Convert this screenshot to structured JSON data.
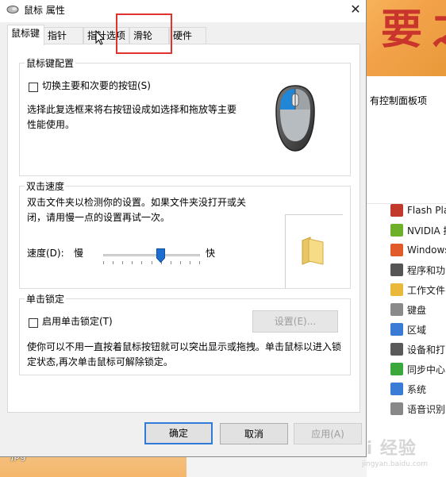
{
  "background": {
    "photo_chars": [
      "要",
      "之"
    ],
    "all_items_text": "有控制面板项",
    "items": [
      {
        "label": "Flash Pla",
        "icon": "flash-icon",
        "color": "#c0392b"
      },
      {
        "label": "NVIDIA 控",
        "icon": "nvidia-icon",
        "color": "#6fb02a"
      },
      {
        "label": "Windows",
        "icon": "windows-defender-icon",
        "color": "#e05a2a"
      },
      {
        "label": "程序和功",
        "icon": "programs-icon",
        "color": "#555555"
      },
      {
        "label": "工作文件",
        "icon": "work-folders-icon",
        "color": "#e8b93a"
      },
      {
        "label": "键盘",
        "icon": "keyboard-icon",
        "color": "#8a8a8a"
      },
      {
        "label": "区域",
        "icon": "region-icon",
        "color": "#3a7bd5"
      },
      {
        "label": "设备和打",
        "icon": "devices-printers-icon",
        "color": "#5a5a5a"
      },
      {
        "label": "同步中心",
        "icon": "sync-center-icon",
        "color": "#3aa83a"
      },
      {
        "label": "系统",
        "icon": "system-icon",
        "color": "#3a7bd5"
      },
      {
        "label": "语音识别",
        "icon": "speech-recognition-icon",
        "color": "#888888"
      }
    ],
    "file_label": "jpg",
    "watermark": "Bai 经验",
    "watermark_url": "jingyan.baidu.com"
  },
  "dialog": {
    "title": "鼠标 属性",
    "close_glyph": "✕",
    "tabs": [
      "鼠标键",
      "指针",
      "指针选项",
      "滑轮",
      "硬件"
    ],
    "active_tab": 0,
    "button_config": {
      "group_label": "鼠标键配置",
      "switch_label": "切换主要和次要的按钮(S)",
      "switch_checked": false,
      "description": "选择此复选框来将右按钮设成如选择和拖放等主要性能使用。"
    },
    "double_click": {
      "group_label": "双击速度",
      "description": "双击文件夹以检测你的设置。如果文件夹没打开或关闭，请用慢一点的设置再试一次。",
      "speed_label": "速度(D):",
      "slow_label": "慢",
      "fast_label": "快",
      "speed_value": 0.6
    },
    "click_lock": {
      "group_label": "单击锁定",
      "enable_label": "启用单击锁定(T)",
      "enable_checked": false,
      "settings_button": "设置(E)...",
      "description": "使你可以不用一直按着鼠标按钮就可以突出显示或拖拽。单击鼠标以进入锁定状态,再次单击鼠标可解除锁定。"
    },
    "buttons": {
      "ok": "确定",
      "cancel": "取消",
      "apply": "应用(A)"
    }
  },
  "colors": {
    "highlight": "#e0322f",
    "accent": "#2f7bd6"
  }
}
